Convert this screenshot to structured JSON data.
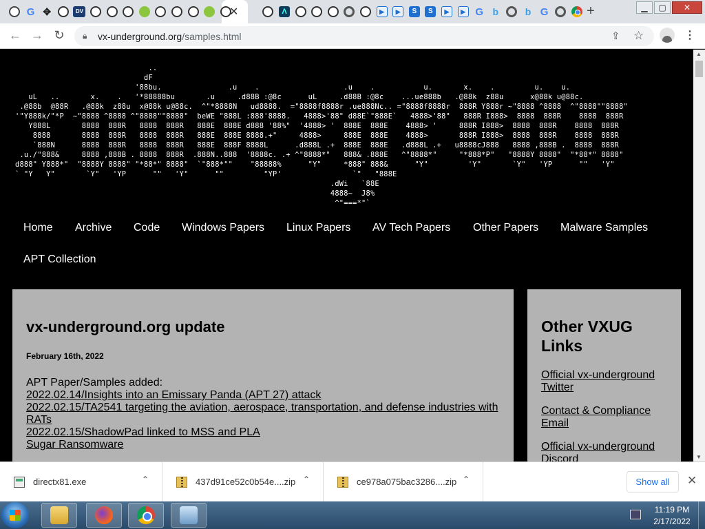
{
  "browser": {
    "tabs": [
      {
        "icon": "tor-icon",
        "glyph": ""
      },
      {
        "icon": "google-icon",
        "glyph": "G"
      },
      {
        "icon": "arrow-icon",
        "glyph": "✥"
      },
      {
        "icon": "github-icon",
        "glyph": ""
      },
      {
        "icon": "dv-icon",
        "glyph": "DV"
      },
      {
        "icon": "github-icon",
        "glyph": ""
      },
      {
        "icon": "github-icon",
        "glyph": ""
      },
      {
        "icon": "github-icon",
        "glyph": ""
      },
      {
        "icon": "green-icon",
        "glyph": ""
      },
      {
        "icon": "github-icon",
        "glyph": ""
      },
      {
        "icon": "github-icon",
        "glyph": ""
      },
      {
        "icon": "github-icon",
        "glyph": ""
      },
      {
        "icon": "green-icon",
        "glyph": ""
      },
      {
        "icon": "github-icon",
        "glyph": ""
      },
      {
        "icon": "github-icon",
        "glyph": ""
      },
      {
        "icon": "triangle-icon",
        "glyph": "Λ"
      },
      {
        "icon": "github-icon",
        "glyph": ""
      },
      {
        "icon": "github-icon",
        "glyph": ""
      },
      {
        "icon": "github-icon",
        "glyph": ""
      },
      {
        "icon": "grey-icon",
        "glyph": ""
      },
      {
        "icon": "github-icon",
        "glyph": ""
      },
      {
        "icon": "play-icon",
        "glyph": "▶"
      },
      {
        "icon": "play-icon",
        "glyph": "▶"
      },
      {
        "icon": "s-icon",
        "glyph": "S"
      },
      {
        "icon": "s-icon",
        "glyph": "S"
      },
      {
        "icon": "play-icon",
        "glyph": "▶"
      },
      {
        "icon": "play-icon",
        "glyph": "▶"
      },
      {
        "icon": "google-icon",
        "glyph": "G"
      },
      {
        "icon": "bing-icon",
        "glyph": "b"
      },
      {
        "icon": "grey-icon",
        "glyph": ""
      },
      {
        "icon": "bing-icon",
        "glyph": "b"
      },
      {
        "icon": "google-icon",
        "glyph": "G"
      },
      {
        "icon": "grey-icon",
        "glyph": ""
      },
      {
        "icon": "chrome-icon",
        "glyph": ""
      }
    ],
    "active_tab_close": "✕",
    "new_tab": "+",
    "window_minimize": "▁",
    "window_maximize": "▢",
    "window_close": "✕",
    "url_host": "vx-underground.org",
    "url_path": "/samples.html"
  },
  "page": {
    "ascii_banner": "                              ..\n                             dF\n                           '88bu.               .u    .                   .u    .           u.       x.    .         u.    u.\n   uL   ..       x.    .   '*88888bu       .u     .d88B :@8c      uL     .d88B :@8c    ...ue888b   .@88k  z88u      x@88k u@88c.\n .@88b  @88R   .@88k  z88u  x@88k u@88c.  ^\"*8888N   ud8888.  =\"8888f8888r .ue888Nc.. =\"8888f8888r  888R Y888r ~\"8888 ^8888  ^\"8888\"\"8888\"\n'\"Y888k/\"*P  ~\"8888 ^8888 ^\"8888\"\"8888\"  beWE \"888L :888'8888.   4888>'88\" d88E`\"888E`   4888>'88\"   888R I888>  8888  888R    8888  888R\n   Y888L       8888  888R   8888  888R   888E  888E d888 '88%\"  '4888> '  888E  888E    4888> '     888R I888>  8888  888R    8888  888R\n    8888       8888  888R   8888  888R   888E  888E 8888.+\"     4888>     888E  888E    4888>       888R I888>  8888  888R    8888  888R\n    `888N      8888  888R   8888  888R   888E  888F 8888L      .d888L .+  888E  888E   .d888L .+   u8888cJ888   8888 ,888B .  8888  888R\n .u./\"888&     8888 ,888B . 8888  888R  .888N..888  '8888c. .+ ^\"8888*\"   888& .888E   ^\"8888*\"     \"*888*P\"   \"8888Y 8888\"  \"*88*\" 8888\"\nd888\" Y888*\"  \"8888Y 8888\" \"*88*\" 8888\"  `\"888*\"\"    \"88888%      \"Y\"     *888\" 888&      \"Y\"         'Y\"       `Y\"   'YP      \"\"   'Y\"\n` \"Y   Y\"       `Y\"   'YP      \"\"   'Y\"      \"\"         \"YP'                `\"   \"888E\n                                                                       .dWi   `88E\n                                                                       4888~  J8%\n                                                                        ^\"===*\"`",
    "nav": [
      "Home",
      "Archive",
      "Code",
      "Windows Papers",
      "Linux Papers",
      "AV Tech Papers",
      "Other Papers",
      "Malware Samples",
      "APT Collection"
    ],
    "post": {
      "title": "vx-underground.org update",
      "date": "February 16th, 2022",
      "intro": "APT Paper/Samples added:",
      "links": [
        "2022.02.14/Insights into an Emissary Panda (APT 27) attack",
        "2022.02.15/TA2541 targeting the aviation, aerospace, transportation, and defense industries with RATs",
        "2022.02.15/ShadowPad linked to MSS and PLA",
        "Sugar Ransomware"
      ]
    },
    "sidebar": {
      "title": "Other VXUG Links",
      "links": [
        "Official vx-underground Twitter",
        "Contact & Compliance Email",
        "Official vx-underground Discord"
      ]
    }
  },
  "downloads": {
    "items": [
      {
        "name": "directx81.exe",
        "type": "exe"
      },
      {
        "name": "437d91ce52c0b54e....zip",
        "type": "zip"
      },
      {
        "name": "ce978a075bac3286....zip",
        "type": "zip"
      }
    ],
    "show_all": "Show all",
    "close": "✕"
  },
  "taskbar": {
    "time": "11:19 PM",
    "date": "2/17/2022"
  }
}
